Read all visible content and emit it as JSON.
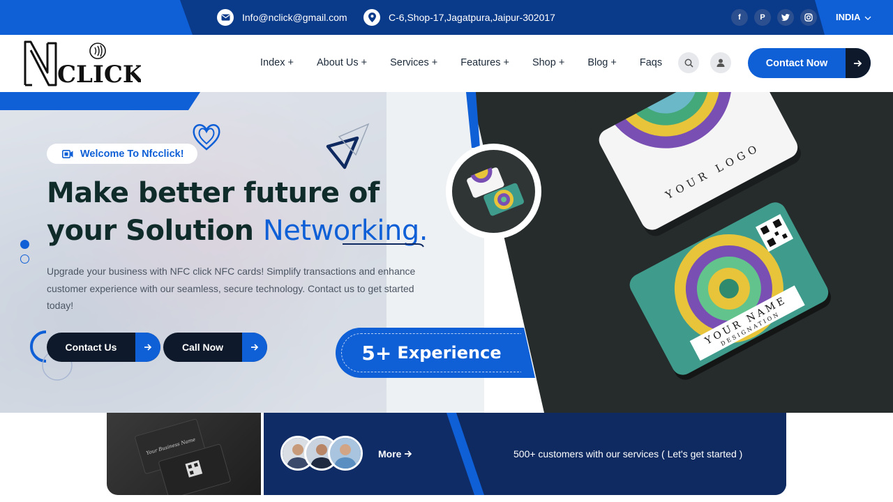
{
  "topbar": {
    "email": "Info@nclick@gmail.com",
    "address": "C-6,Shop-17,Jagatpura,Jaipur-302017",
    "country": "INDIA",
    "social_icons": [
      "facebook-icon",
      "pinterest-icon",
      "twitter-icon",
      "instagram-icon"
    ]
  },
  "header": {
    "logo_letter": "N",
    "logo_text": "CLICK",
    "nav": [
      "Index +",
      "About Us +",
      "Services +",
      "Features +",
      "Shop +",
      "Blog +",
      "Faqs"
    ],
    "cta": "Contact Now"
  },
  "hero": {
    "badge": "Welcome To Nfcclick!",
    "headline_line1": "Make better future of",
    "headline_line2_dark": "your Solution ",
    "headline_line2_accent": "Networking.",
    "description": "Upgrade your business with NFC click NFC cards! Simplify transactions and enhance customer experience with our seamless, secure technology. Contact us to get started today!",
    "btn_contact": "Contact Us",
    "btn_call": "Call Now",
    "experience_number": "5+",
    "experience_word": "Experience",
    "card_text_logo": "YOUR LOGO",
    "card_text_name": "YOUR NAME",
    "card_text_designation": "DESIGNATION"
  },
  "strip": {
    "more": "More",
    "customers": "500+ customers with our services ( Let's get started )",
    "card_script": "Your Business Name"
  },
  "colors": {
    "primary": "#0f5fd6",
    "navy": "#0a3a8a",
    "dark": "#0e1a2b",
    "heading": "#0f2b2a"
  }
}
